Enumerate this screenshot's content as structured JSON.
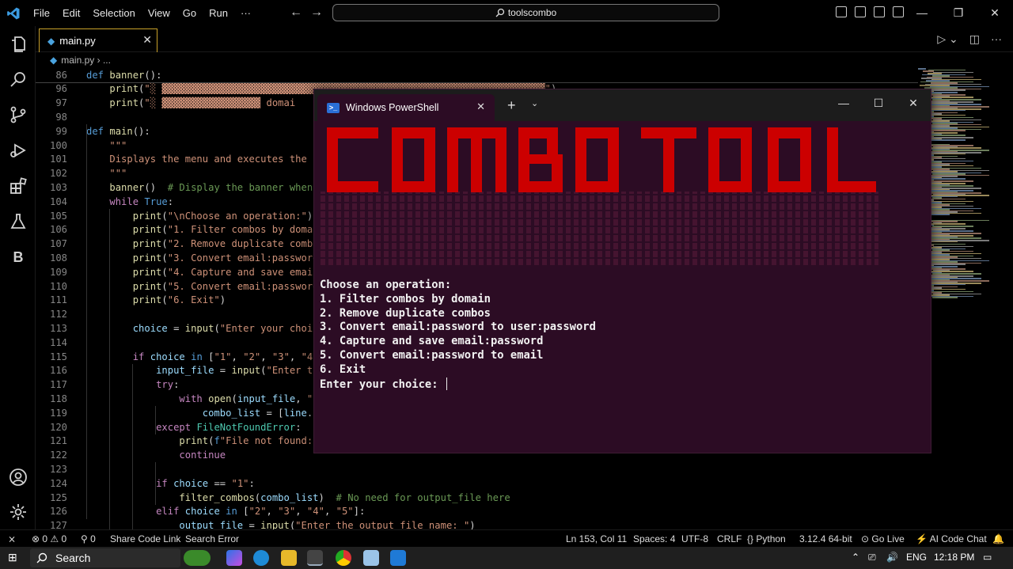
{
  "titlebar": {
    "menus": [
      "File",
      "Edit",
      "Selection",
      "View",
      "Go",
      "Run",
      "···"
    ],
    "search": "toolscombo"
  },
  "tab": {
    "label": "main.py"
  },
  "breadcrumb": {
    "file": "main.py",
    "more": "..."
  },
  "editor": {
    "lines": [
      {
        "n": "86",
        "html": "<span class='kw2'>def</span> <span class='fn'>banner</span>():"
      },
      {
        "n": "96",
        "html": "    <span class='fn'>print</span>(<span class='st'>\"░ ▓▓▓▓▓▓▓▓▓▓▓▓▓▓▓▓▓▓▓▓▓▓▓▓▓▓▓▓▓▓▓▓▓▓▓▓▓▓▓▓▓▓▓▓▓▓▓▓▓▓▓▓▓▓▓▓▓▓▓▓▓▓▓▓▓▓\"</span>)"
      },
      {
        "n": "97",
        "html": "    <span class='fn'>print</span>(<span class='st'>\"░ ▓▓▓▓▓▓▓▓▓▓▓▓▓▓▓▓▓ domai</span>"
      },
      {
        "n": "98",
        "html": ""
      },
      {
        "n": "99",
        "html": "<span class='kw2'>def</span> <span class='fn'>main</span>():"
      },
      {
        "n": "100",
        "html": "    <span class='st'>\"\"\"</span>"
      },
      {
        "n": "101",
        "html": "    <span class='st'>Displays the menu and executes the f</span>"
      },
      {
        "n": "102",
        "html": "    <span class='st'>\"\"\"</span>"
      },
      {
        "n": "103",
        "html": "    <span class='fn'>banner</span>()  <span class='cm'># Display the banner when</span>"
      },
      {
        "n": "104",
        "html": "    <span class='kw'>while</span> <span class='kw2'>True</span>:"
      },
      {
        "n": "105",
        "html": "        <span class='fn'>print</span>(<span class='st'>\"\\nChoose an operation:\"</span>)"
      },
      {
        "n": "106",
        "html": "        <span class='fn'>print</span>(<span class='st'>\"1. Filter combos by domai</span>"
      },
      {
        "n": "107",
        "html": "        <span class='fn'>print</span>(<span class='st'>\"2. Remove duplicate combo</span>"
      },
      {
        "n": "108",
        "html": "        <span class='fn'>print</span>(<span class='st'>\"3. Convert email:password</span>"
      },
      {
        "n": "109",
        "html": "        <span class='fn'>print</span>(<span class='st'>\"4. Capture and save email</span>"
      },
      {
        "n": "110",
        "html": "        <span class='fn'>print</span>(<span class='st'>\"5. Convert email:password</span>"
      },
      {
        "n": "111",
        "html": "        <span class='fn'>print</span>(<span class='st'>\"6. Exit\"</span>)"
      },
      {
        "n": "112",
        "html": ""
      },
      {
        "n": "113",
        "html": "        <span class='vr'>choice</span> = <span class='fn'>input</span>(<span class='st'>\"Enter your choic</span>"
      },
      {
        "n": "114",
        "html": ""
      },
      {
        "n": "115",
        "html": "        <span class='kw'>if</span> <span class='vr'>choice</span> <span class='kw2'>in</span> [<span class='st'>\"1\"</span>, <span class='st'>\"2\"</span>, <span class='st'>\"3\"</span>, <span class='st'>\"4\"</span>"
      },
      {
        "n": "116",
        "html": "            <span class='vr'>input_file</span> = <span class='fn'>input</span>(<span class='st'>\"Enter th</span>"
      },
      {
        "n": "117",
        "html": "            <span class='kw'>try</span>:"
      },
      {
        "n": "118",
        "html": "                <span class='kw'>with</span> <span class='fn'>open</span>(<span class='vr'>input_file</span>, <span class='st'>\"r</span>"
      },
      {
        "n": "119",
        "html": "                    <span class='vr'>combo_list</span> = [<span class='vr'>line</span>.<span class='fn'>s</span>"
      },
      {
        "n": "120",
        "html": "            <span class='kw'>except</span> <span class='cls'>FileNotFoundError</span>:"
      },
      {
        "n": "121",
        "html": "                <span class='fn'>print</span>(<span class='kw2'>f</span><span class='st'>\"File not found:</span>"
      },
      {
        "n": "122",
        "html": "                <span class='kw'>continue</span>"
      },
      {
        "n": "123",
        "html": ""
      },
      {
        "n": "124",
        "html": "            <span class='kw'>if</span> <span class='vr'>choice</span> == <span class='st'>\"1\"</span>:"
      },
      {
        "n": "125",
        "html": "                <span class='fn'>filter_combos</span>(<span class='vr'>combo_list</span>)  <span class='cm'># No need for output_file here</span>"
      },
      {
        "n": "126",
        "html": "            <span class='kw'>elif</span> <span class='vr'>choice</span> <span class='kw2'>in</span> [<span class='st'>\"2\"</span>, <span class='st'>\"3\"</span>, <span class='st'>\"4\"</span>, <span class='st'>\"5\"</span>]:"
      },
      {
        "n": "127",
        "html": "                <span class='vr'>output_file</span> = <span class='fn'>input</span>(<span class='st'>\"Enter the output file name: \"</span>)"
      }
    ]
  },
  "terminal": {
    "title": "Windows PowerShell",
    "banner_text": "COMBO TOOL",
    "output": [
      "Choose an operation:",
      "1. Filter combos by domain",
      "2. Remove duplicate combos",
      "3. Convert email:password to user:password",
      "4. Capture and save email:password",
      "5. Convert email:password to email",
      "6. Exit"
    ],
    "prompt": "Enter your choice: "
  },
  "statusbar": {
    "errors": "0",
    "warnings": "0",
    "ports": "0",
    "share": "Share Code Link",
    "search_error": "Search Error",
    "position": "Ln 153, Col 11",
    "spaces": "Spaces: 4",
    "encoding": "UTF-8",
    "eol": "CRLF",
    "language": "Python",
    "interpreter": "3.12.4 64-bit",
    "golive": "Go Live",
    "ai": "AI Code Chat"
  },
  "taskbar": {
    "search": "Search",
    "lang": "ENG",
    "time": "12:18 PM"
  },
  "colors": {
    "terminal_bg": "#2c0c24",
    "banner_red": "#cc0000",
    "tab_border": "#c9a12a"
  }
}
